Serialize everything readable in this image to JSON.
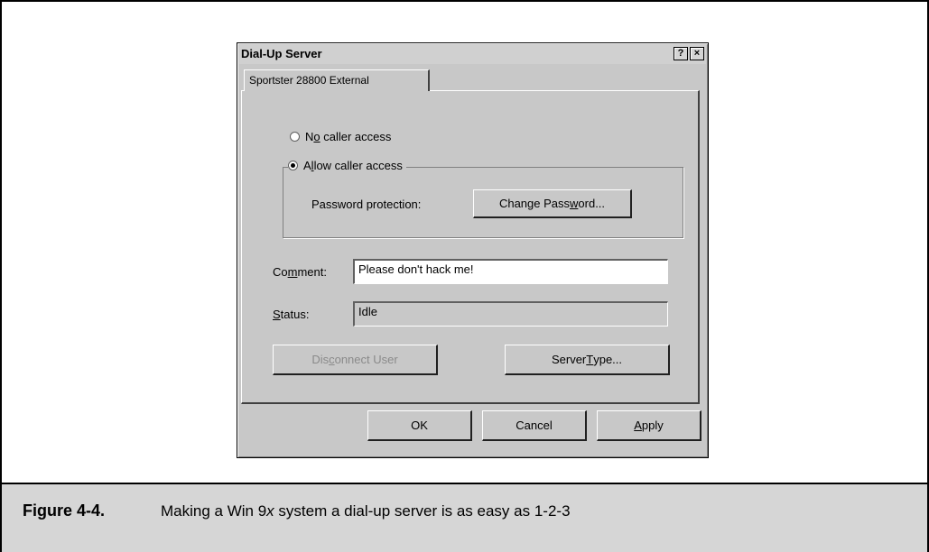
{
  "dialog": {
    "title": "Dial-Up Server",
    "help_label": "?",
    "close_label": "×",
    "tab_label": "Sportster 28800 External"
  },
  "access": {
    "no_caller_parts": [
      "N",
      "o",
      " caller access"
    ],
    "allow_caller_parts": [
      "A",
      "l",
      "low caller access"
    ],
    "selected": "allow"
  },
  "password": {
    "label": "Password protection:",
    "button_parts": [
      "Change Pass",
      "w",
      "ord..."
    ]
  },
  "comment": {
    "label_parts": [
      "Co",
      "m",
      "ment:"
    ],
    "value": "Please don't hack me!"
  },
  "status": {
    "label_parts": [
      "",
      "S",
      "tatus:"
    ],
    "value": "Idle"
  },
  "actions": {
    "disconnect_parts": [
      "Dis",
      "c",
      "onnect User"
    ],
    "server_type_parts": [
      "Server ",
      "T",
      "ype..."
    ]
  },
  "footer": {
    "ok": "OK",
    "cancel": "Cancel",
    "apply_parts": [
      "",
      "A",
      "pply"
    ]
  },
  "caption": {
    "number": "Figure 4-4.",
    "text_before": "Making a Win 9",
    "text_italic": "x",
    "text_after": " system a dial-up server is as easy as 1-2-3"
  }
}
